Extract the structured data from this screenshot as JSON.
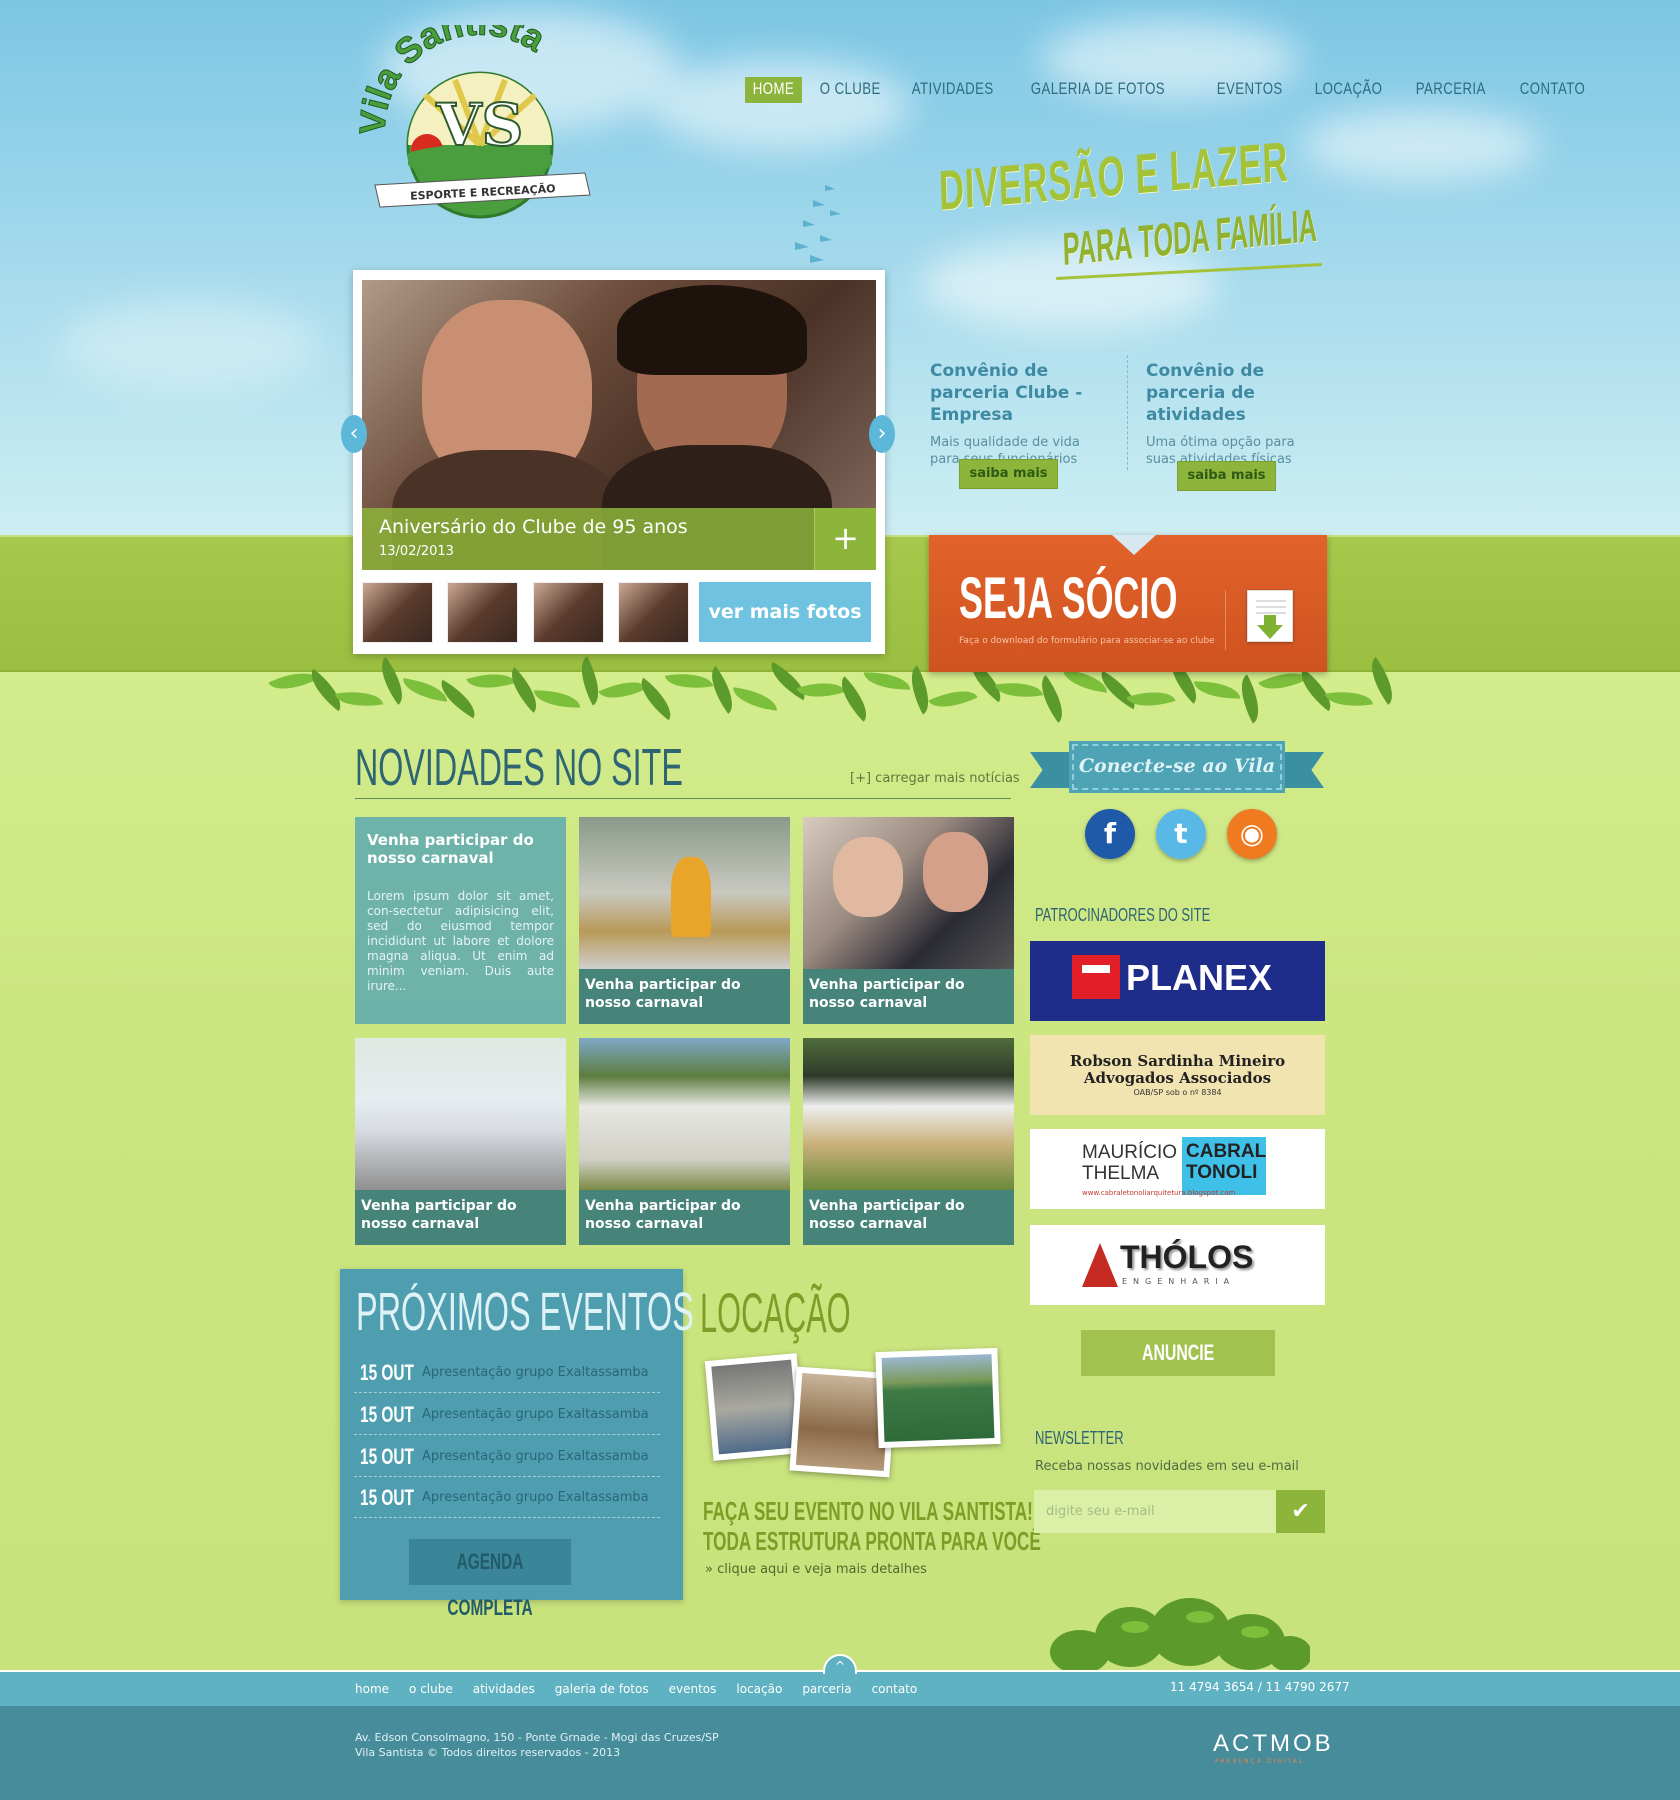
{
  "brand": {
    "name": "Vila Santista",
    "monogram": "VS",
    "ribbon": "ESPORTE E RECREAÇÃO"
  },
  "nav": [
    "HOME",
    "O CLUBE",
    "ATIVIDADES",
    "GALERIA DE FOTOS",
    "EVENTOS",
    "LOCAÇÃO",
    "PARCERIA",
    "CONTATO"
  ],
  "hero": {
    "tagline_line1": "DIVERSÃO E LAZER",
    "tagline_line2": "PARA TODA FAMÍLIA"
  },
  "convenios": [
    {
      "title": "Convênio de parceria Clube - Empresa",
      "text": "Mais qualidade de vida para seus funcionários",
      "button": "saiba mais"
    },
    {
      "title": "Convênio de parceria de atividades",
      "text": "Uma ótima opção para suas atividades físicas",
      "button": "saiba mais"
    }
  ],
  "slider": {
    "caption": "Aniversário do Clube de 95 anos",
    "date": "13/02/2013",
    "plus": "+",
    "more_photos": "ver mais fotos",
    "prev": "‹",
    "next": "›"
  },
  "socio": {
    "title": "SEJA SÓCIO",
    "subtitle": "Faça o download do formulário para associar-se ao clube"
  },
  "news": {
    "title": "NOVIDADES NO SITE",
    "more": "[+] carregar mais notícias",
    "featured": {
      "title": "Venha participar do nosso carnaval",
      "text": "Lorem ipsum dolor sit amet, con-sectetur adipisicing elit, sed do eiusmod tempor incididunt ut labore et dolore magna aliqua. Ut enim ad minim veniam. Duis aute irure..."
    },
    "items": [
      "Venha participar do nosso carnaval",
      "Venha participar do nosso carnaval",
      "Venha participar do nosso carnaval",
      "Venha participar do nosso carnaval",
      "Venha participar do nosso carnaval"
    ]
  },
  "events": {
    "title": "PRÓXIMOS EVENTOS",
    "items": [
      {
        "date": "15 OUT",
        "desc": "Apresentação grupo Exaltassamba"
      },
      {
        "date": "15 OUT",
        "desc": "Apresentação grupo Exaltassamba"
      },
      {
        "date": "15 OUT",
        "desc": "Apresentação grupo Exaltassamba"
      },
      {
        "date": "15 OUT",
        "desc": "Apresentação grupo Exaltassamba"
      }
    ],
    "button": "AGENDA COMPLETA"
  },
  "locacao": {
    "title": "LOCAÇÃO",
    "heading1": "FAÇA SEU EVENTO NO VILA SANTISTA!",
    "heading2": "TODA ESTRUTURA PRONTA PARA VOCÊ",
    "link": "» clique aqui e veja mais detalhes"
  },
  "sidebar": {
    "connect": "Conecte-se ao Vila",
    "social": [
      {
        "name": "facebook",
        "glyph": "f",
        "color": "#1f5aa8"
      },
      {
        "name": "twitter",
        "glyph": "t",
        "color": "#5ab8e6"
      },
      {
        "name": "rss",
        "glyph": "◉",
        "color": "#f07a1f"
      }
    ],
    "sponsors_title": "PATROCINADORES DO SITE",
    "sponsors": [
      {
        "line1": "PLANEX"
      },
      {
        "line1": "Robson Sardinha Mineiro",
        "line2": "Advogados Associados",
        "line3": "OAB/SP sob o nº 8384"
      },
      {
        "line1": "MAURÍCIO",
        "line2": "THELMA",
        "line3": "CABRAL",
        "line4": "TONOLI",
        "line5": "www.cabraletonoliarquitetura.blogspot.com"
      },
      {
        "line1": "THÓLOS",
        "line2": "ENGENHARIA"
      }
    ],
    "advertise": "ANUNCIE",
    "newsletter_title": "NEWSLETTER",
    "newsletter_sub": "Receba nossas novidades em seu e-mail",
    "newsletter_placeholder": "digite seu e-mail",
    "newsletter_button": "✔"
  },
  "footer": {
    "nav": [
      "home",
      "o clube",
      "atividades",
      "galeria de fotos",
      "eventos",
      "locação",
      "parceria",
      "contato"
    ],
    "phones": "11 4794 3654 / 11 4790 2677",
    "address": "Av. Edson Consolmagno, 150 - Ponte Grnade - Mogi das Cruzes/SP",
    "copyright": "Vila Santista © Todos direitos reservados - 2013",
    "credit": "ACTMOB",
    "credit_sub": "PRESENÇA DIGITAL",
    "up": "^"
  },
  "colors": {
    "accent_green": "#8db43b",
    "teal": "#4e9eb0",
    "orange": "#d7581f",
    "sky": "#7cc6e4"
  }
}
